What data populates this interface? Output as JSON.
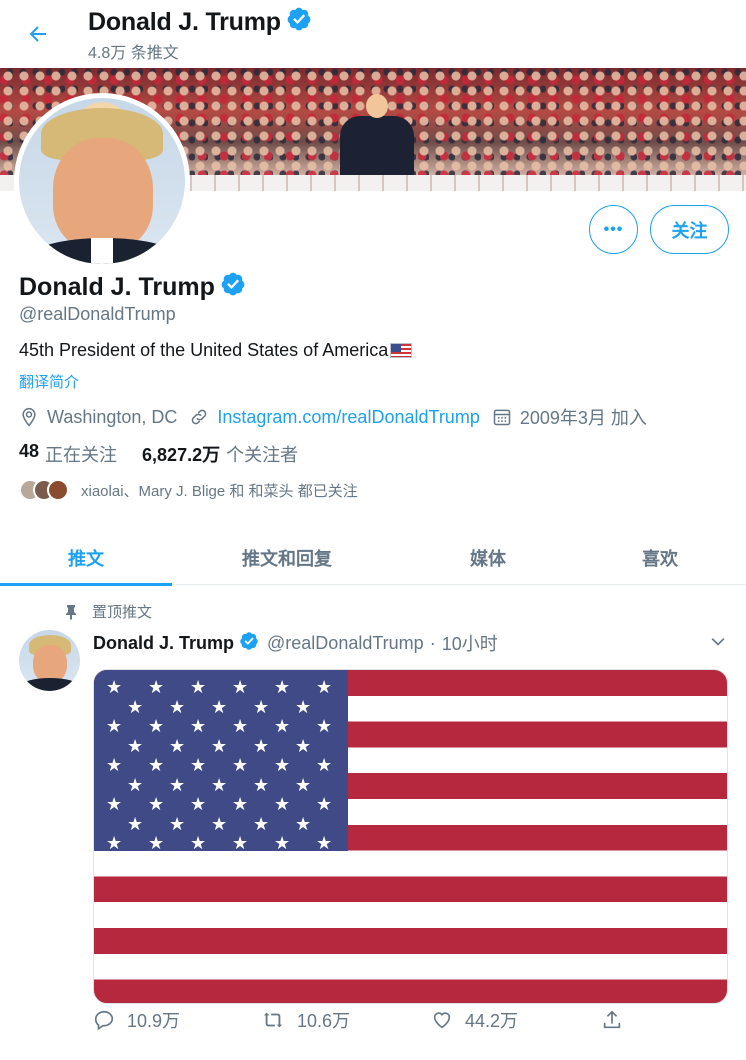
{
  "header": {
    "back_icon": "arrow-left-icon",
    "name": "Donald J. Trump",
    "tweet_count": "4.8万 条推文"
  },
  "profile": {
    "name": "Donald J. Trump",
    "handle": "@realDonaldTrump",
    "bio": "45th President of the United States of America",
    "translate_label": "翻译简介",
    "location": "Washington, DC",
    "website": "Instagram.com/realDonaldTrump",
    "joined": "2009年3月 加入",
    "following_count": "48",
    "following_label": "正在关注",
    "followers_count": "6,827.2万",
    "followers_label": "个关注者",
    "followed_by": "xiaolai、Mary J. Blige 和 和菜头 都已关注",
    "more_label": "•••",
    "follow_label": "关注"
  },
  "tabs": [
    {
      "label": "推文",
      "active": true
    },
    {
      "label": "推文和回复",
      "active": false
    },
    {
      "label": "媒体",
      "active": false
    },
    {
      "label": "喜欢",
      "active": false
    }
  ],
  "tweet": {
    "pinned_label": "置顶推文",
    "name": "Donald J. Trump",
    "handle": "@realDonaldTrump",
    "separator": "·",
    "time": "10小时",
    "replies": "10.9万",
    "retweets": "10.6万",
    "likes": "44.2万"
  },
  "colors": {
    "accent": "#1da1f2",
    "text": "#14171a",
    "muted": "#657786"
  }
}
